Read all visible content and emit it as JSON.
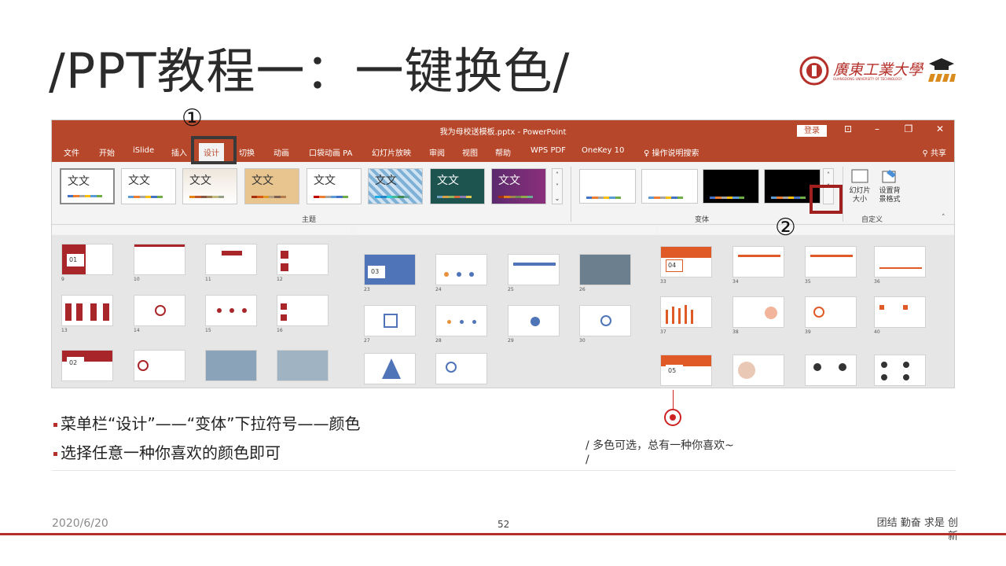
{
  "slide": {
    "title": "/PPT教程一：一键换色/",
    "logo_text": "廣東工業大學",
    "logo_sub": "GUANGDONG UNIVERSITY OF TECHNOLOGY"
  },
  "ppt_window": {
    "doc_title": "我为母校送模板.pptx - PowerPoint",
    "login_label": "登录",
    "menu": [
      "文件",
      "开始",
      "iSlide",
      "插入",
      "设计",
      "切换",
      "动画",
      "口袋动画 PA",
      "幻灯片放映",
      "审阅",
      "视图",
      "帮助",
      "WPS PDF",
      "OneKey 10",
      "操作说明搜索"
    ],
    "share_label": "共享",
    "themes_group_label": "主题",
    "variants_group_label": "变体",
    "custom_group_label": "自定义",
    "theme_thumb_text": "文文",
    "custom_buttons": [
      {
        "label": "幻灯片\n大小"
      },
      {
        "label": "设置背\n景格式"
      }
    ],
    "thumbnail_captions": {
      "section_numbers": [
        "01",
        "02",
        "03",
        "04",
        "05"
      ],
      "slide_numbers": [
        "9",
        "10",
        "11",
        "12",
        "13",
        "14",
        "15",
        "16",
        "23",
        "24",
        "25",
        "26",
        "27",
        "28",
        "29",
        "30",
        "33",
        "34",
        "35",
        "36",
        "37",
        "38",
        "39",
        "40"
      ]
    }
  },
  "markers": {
    "step1": "①",
    "step2": "②"
  },
  "bullets": [
    "菜单栏“设计”——“变体”下拉符号——颜色",
    "选择任意一种你喜欢的颜色即可"
  ],
  "note": {
    "line1": "/ 多色可选，总有一种你喜欢~",
    "line2": "/"
  },
  "footer": {
    "date": "2020/6/20",
    "page": "52",
    "motto_line1": "团结 勤奋 求是 创",
    "motto_line2": "新"
  },
  "colors": {
    "accent": "#b5302a",
    "ppt_orange": "#b7472a"
  }
}
